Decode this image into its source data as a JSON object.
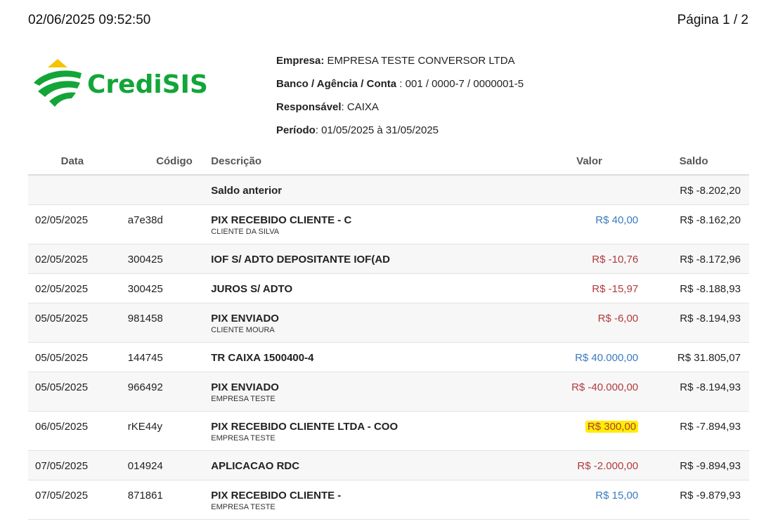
{
  "header": {
    "datetime": "02/06/2025 09:52:50",
    "page": "Página 1 / 2"
  },
  "logo": {
    "text": "CrediSIS",
    "colors": {
      "green": "#13a538",
      "yellow": "#f5c400"
    }
  },
  "info": {
    "empresa_label": "Empresa:",
    "empresa": " EMPRESA TESTE CONVERSOR LTDA",
    "conta_label": "Banco / Agência / Conta",
    "conta": " : 001 / 0000-7 / 0000001-5",
    "responsavel_label": "Responsável",
    "responsavel": ": CAIXA",
    "periodo_label": "Período",
    "periodo": ": 01/05/2025 à 31/05/2025"
  },
  "table": {
    "columns": [
      "Data",
      "Código",
      "Descrição",
      "Valor",
      "Saldo"
    ],
    "opening": {
      "label": "Saldo anterior",
      "saldo": "R$ -8.202,20"
    },
    "rows": [
      {
        "date": "02/05/2025",
        "code": "a7e38d",
        "desc": "PIX RECEBIDO CLIENTE - C",
        "sub": "CLIENTE DA SILVA",
        "value": "R$ 40,00",
        "saldo": "R$ -8.162,20"
      },
      {
        "date": "02/05/2025",
        "code": "300425",
        "desc": "IOF S/ ADTO DEPOSITANTE IOF(AD",
        "sub": "",
        "value": "R$ -10,76",
        "saldo": "R$ -8.172,96"
      },
      {
        "date": "02/05/2025",
        "code": "300425",
        "desc": "JUROS S/ ADTO",
        "sub": "",
        "value": "R$ -15,97",
        "saldo": "R$ -8.188,93"
      },
      {
        "date": "05/05/2025",
        "code": "981458",
        "desc": "PIX ENVIADO",
        "sub": "CLIENTE MOURA",
        "value": "R$ -6,00",
        "saldo": "R$ -8.194,93"
      },
      {
        "date": "05/05/2025",
        "code": "144745",
        "desc": "TR CAIXA 1500400-4",
        "sub": "",
        "value": "R$ 40.000,00",
        "saldo": "R$ 31.805,07"
      },
      {
        "date": "05/05/2025",
        "code": "966492",
        "desc": "PIX ENVIADO",
        "sub": "EMPRESA TESTE",
        "value": "R$ -40.000,00",
        "saldo": "R$ -8.194,93"
      },
      {
        "date": "06/05/2025",
        "code": "rKE44y",
        "desc": "PIX RECEBIDO CLIENTE LTDA - COO",
        "sub": "EMPRESA TESTE",
        "value": "R$ 300,00",
        "saldo": "R$ -7.894,93"
      },
      {
        "date": "07/05/2025",
        "code": "014924",
        "desc": "APLICACAO RDC",
        "sub": "",
        "value": "R$ -2.000,00",
        "saldo": "R$ -9.894,93"
      },
      {
        "date": "07/05/2025",
        "code": "871861",
        "desc": "PIX RECEBIDO CLIENTE -",
        "sub": "EMPRESA TESTE",
        "value": "R$ 15,00",
        "saldo": "R$ -9.879,93"
      }
    ]
  }
}
